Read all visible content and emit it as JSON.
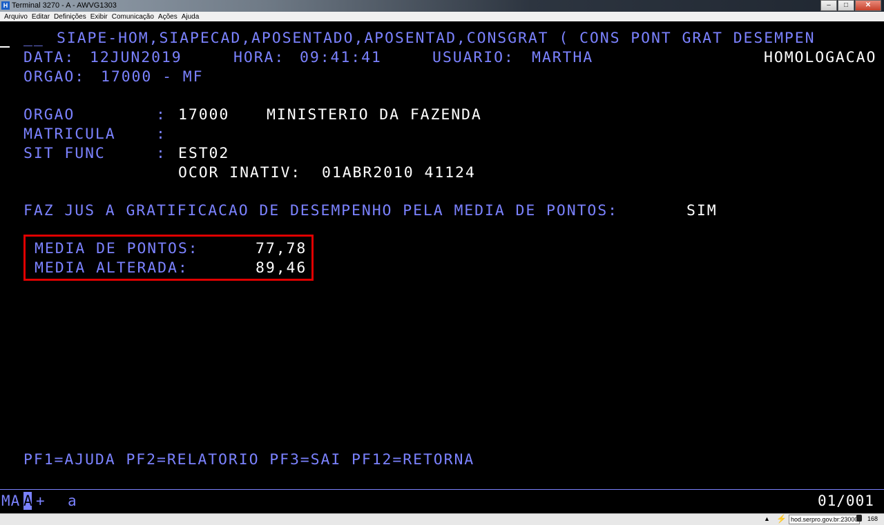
{
  "window": {
    "title": "Terminal 3270 - A - AWVG1303",
    "icon_letter": "H",
    "controls": {
      "minimize": "–",
      "maximize": "□",
      "close": "✕"
    }
  },
  "menu": [
    "Arquivo",
    "Editar",
    "Definições",
    "Exibir",
    "Comunicação",
    "Ações",
    "Ajuda"
  ],
  "screen": {
    "line1": {
      "input_mark": "__",
      "path": "SIAPE-HOM,SIAPECAD,APOSENTADO,APOSENTAD,CONSGRAT ( CONS PONT GRAT DESEMPEN"
    },
    "line2": {
      "data_label": "DATA:",
      "data_value": "12JUN2019",
      "hora_label": "HORA:",
      "hora_value": "09:41:41",
      "usuario_label": "USUARIO:",
      "usuario_value": "MARTHA",
      "env": "HOMOLOGACAO"
    },
    "line3": {
      "orgao_label": "ORGAO:",
      "orgao_value": "17000 - MF"
    },
    "orgao": {
      "label": "ORGAO",
      "sep": ":",
      "code": "17000",
      "name": "MINISTERIO DA FAZENDA"
    },
    "matricula": {
      "label": "MATRICULA",
      "sep": ":"
    },
    "sit_func": {
      "label": "SIT FUNC",
      "sep": ":",
      "value": "EST02"
    },
    "ocor": {
      "label": "OCOR INATIV:",
      "value": "01ABR2010 41124"
    },
    "faz_jus": {
      "label": "FAZ JUS A GRATIFICACAO DE DESEMPENHO PELA MEDIA DE PONTOS:",
      "value": "SIM"
    },
    "media_pontos": {
      "label": "MEDIA DE PONTOS:",
      "value": "77,78"
    },
    "media_alterada": {
      "label": "MEDIA ALTERADA:",
      "value": "89,46"
    },
    "pf_keys": "PF1=AJUDA PF2=RELATORIO PF3=SAI PF12=RETORNA"
  },
  "oia": {
    "mode": "MA",
    "cursor": "A",
    "plus": "+",
    "a": "a",
    "page": "01/001"
  },
  "status": {
    "host": "hod.serpro.gov.br:23000",
    "count": "168"
  }
}
